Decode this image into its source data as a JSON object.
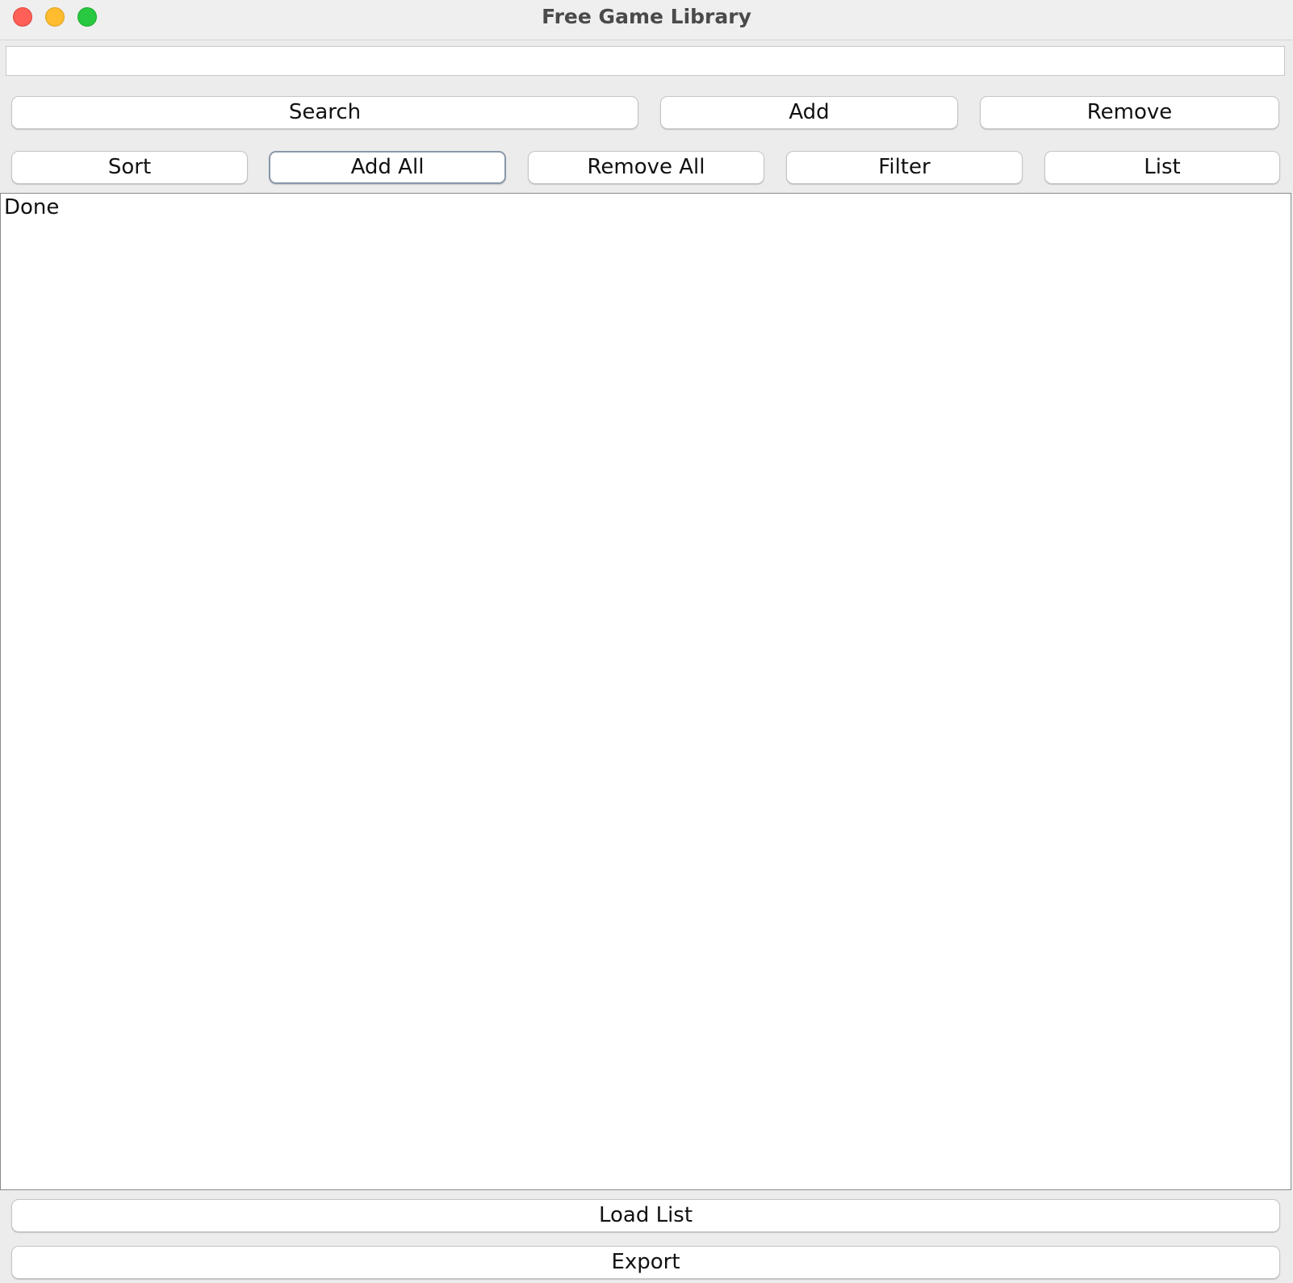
{
  "window": {
    "title": "Free Game Library"
  },
  "search": {
    "value": "",
    "placeholder": ""
  },
  "buttons_row1": {
    "search": "Search",
    "add": "Add",
    "remove": "Remove"
  },
  "buttons_row2": {
    "sort": "Sort",
    "add_all": "Add All",
    "remove_all": "Remove All",
    "filter": "Filter",
    "list": "List"
  },
  "output": {
    "text": "Done"
  },
  "footer": {
    "load_list": "Load List",
    "export": "Export"
  }
}
